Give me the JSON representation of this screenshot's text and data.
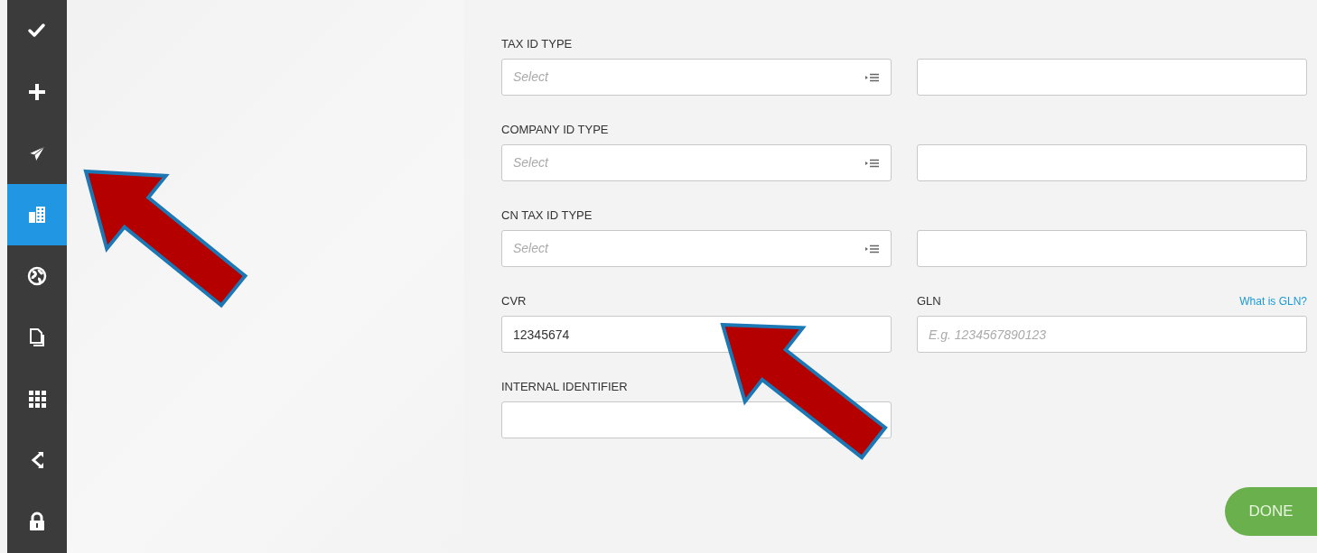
{
  "sidebar": {
    "items": [
      {
        "selected": false
      },
      {
        "selected": false
      },
      {
        "selected": false
      },
      {
        "selected": true
      },
      {
        "selected": false
      },
      {
        "selected": false
      },
      {
        "selected": false
      },
      {
        "selected": false
      },
      {
        "selected": false
      }
    ]
  },
  "form": {
    "rows": [
      {
        "left": {
          "label": "TAX ID TYPE",
          "kind": "select",
          "placeholder": "Select"
        },
        "right": {
          "kind": "text"
        }
      },
      {
        "left": {
          "label": "COMPANY ID TYPE",
          "kind": "select",
          "placeholder": "Select"
        },
        "right": {
          "kind": "text"
        }
      },
      {
        "left": {
          "label": "CN TAX ID TYPE",
          "kind": "select",
          "placeholder": "Select"
        },
        "right": {
          "kind": "text"
        }
      },
      {
        "left": {
          "label": "CVR",
          "kind": "text",
          "value": "12345674"
        },
        "right": {
          "label": "GLN",
          "link": "What is GLN?",
          "kind": "text",
          "placeholder": "E.g. 1234567890123"
        }
      },
      {
        "left": {
          "label": "INTERNAL IDENTIFIER",
          "kind": "text"
        }
      }
    ]
  },
  "done_button": "DONE",
  "annotations": [
    {
      "kind": "arrow"
    },
    {
      "kind": "arrow"
    }
  ]
}
